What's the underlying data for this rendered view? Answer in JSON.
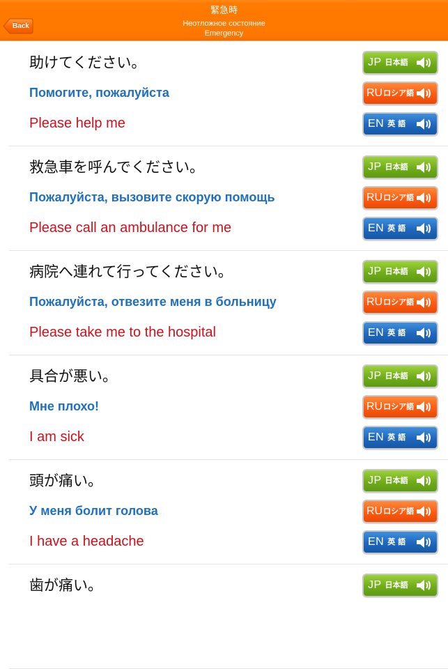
{
  "header": {
    "title_jp": "緊急時",
    "title_ru": "Неотложное состояние",
    "title_en": "Emergency",
    "back_label": "Back",
    "color": "#ff7700"
  },
  "buttons": {
    "jp": {
      "code": "JP",
      "lang": "日本語",
      "icon": "speaker-icon",
      "color": "#70ad1a"
    },
    "ru": {
      "code": "RU",
      "lang": "ロシア語",
      "icon": "speaker-icon",
      "color": "#ff5a10"
    },
    "en": {
      "code": "EN",
      "lang": "英 語",
      "icon": "speaker-icon",
      "color": "#1f66bd"
    }
  },
  "colors": {
    "jp_text": "#111111",
    "ru_text": "#1f6fc4",
    "en_text": "#d0101a"
  },
  "phrases": [
    {
      "jp": "助けてください。",
      "ru": "Помогите, пожалуйста",
      "en": "Please help me"
    },
    {
      "jp": "救急車を呼んでください。",
      "ru": "Пожалуйста, вызовите скорую помощь",
      "en": "Please call an ambulance for me"
    },
    {
      "jp": "病院へ連れて行ってください。",
      "ru": "Пожалуйста, отвезите меня в больницу",
      "en": "Please take me to the hospital"
    },
    {
      "jp": "具合が悪い。",
      "ru": "Мне плохо!",
      "en": "I am sick"
    },
    {
      "jp": "頭が痛い。",
      "ru": "У меня болит голова",
      "en": "I have a headache"
    },
    {
      "jp": "歯が痛い。",
      "ru": null,
      "en": null
    }
  ]
}
